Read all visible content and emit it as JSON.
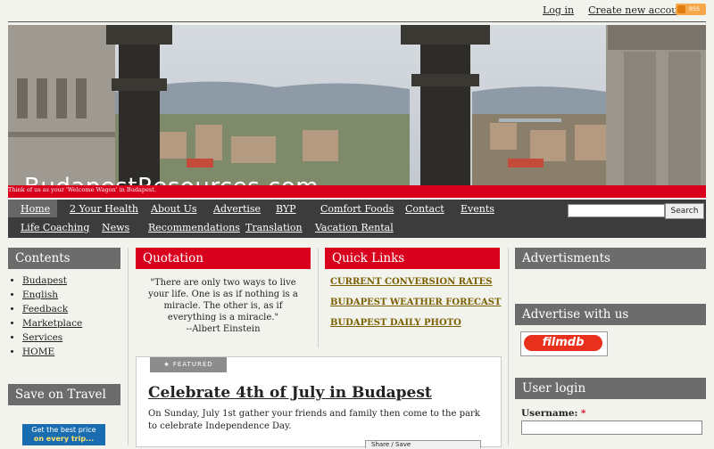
{
  "header": {
    "login_label": "Log in",
    "create_account_label": "Create new account",
    "rss_label": "RSS"
  },
  "banner": {
    "site_name": "BudapestResources.com",
    "tagline": "Think of us as your 'Welcome Wagon' in Budapest."
  },
  "nav": {
    "items": [
      "Home",
      "2 Your Health",
      "About Us",
      "Advertise",
      "BYP",
      "Comfort Foods",
      "Contact",
      "Events",
      "Life Coaching",
      "News",
      "Recommendations",
      "Translation",
      "Vacation Rental"
    ],
    "search_button": "Search"
  },
  "left": {
    "contents_title": "Contents",
    "contents_items": [
      "Budapest",
      "English",
      "Feedback",
      "Marketplace",
      "Services",
      "HOME"
    ],
    "travel_title": "Save on Travel",
    "travel_ad_line1": "Get the best price",
    "travel_ad_line2": "on every trip..."
  },
  "quotation": {
    "title": "Quotation",
    "text": "\"There are only two ways to live your life. One is as if nothing is a miracle. The other is, as if everything is a miracle.\"",
    "author": "--Albert Einstein"
  },
  "quick_links": {
    "title": "Quick Links",
    "links": [
      "CURRENT CONVERSION RATES",
      "BUDAPEST WEATHER FORECAST",
      "BUDAPEST DAILY PHOTO"
    ]
  },
  "featured": {
    "tag": "FEATURED",
    "title": "Celebrate 4th of July in Budapest",
    "body": "On Sunday, July 1st gather your friends and family then come to the park to celebrate Independence Day.",
    "share_label": "Share / Save"
  },
  "right": {
    "ads_title": "Advertisments",
    "advertise_title": "Advertise with us",
    "filmdb_logo": "filmdb",
    "login_title": "User login",
    "username_label": "Username:",
    "required_mark": "*"
  }
}
